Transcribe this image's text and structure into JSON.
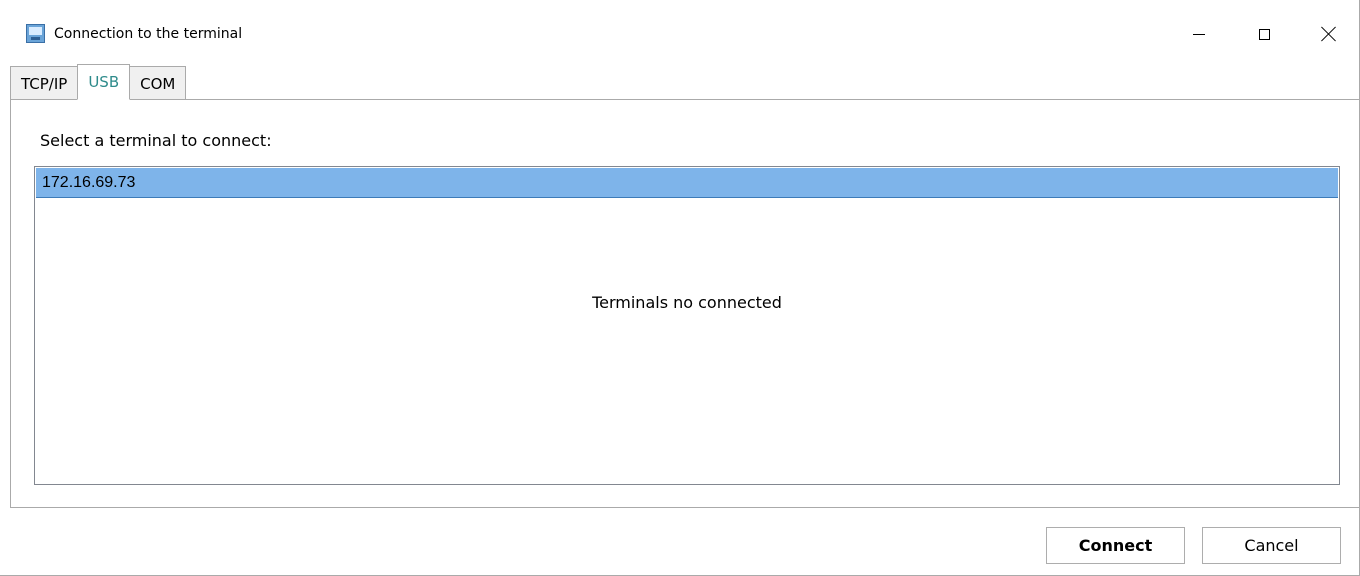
{
  "window": {
    "title": "Connection to the terminal"
  },
  "tabs": [
    {
      "label": "TCP/IP",
      "active": false
    },
    {
      "label": "USB",
      "active": true
    },
    {
      "label": "COM",
      "active": false
    }
  ],
  "main": {
    "prompt": "Select a terminal to connect:",
    "list_items": [
      "172.16.69.73"
    ],
    "empty_message": "Terminals no connected"
  },
  "buttons": {
    "connect_label": "Connect",
    "cancel_label": "Cancel"
  },
  "colors": {
    "active_tab_text": "#2e8b8b",
    "selected_row": "#7eb4ea"
  },
  "icons": [
    "app-icon",
    "minimize-icon",
    "maximize-icon",
    "close-icon"
  ]
}
